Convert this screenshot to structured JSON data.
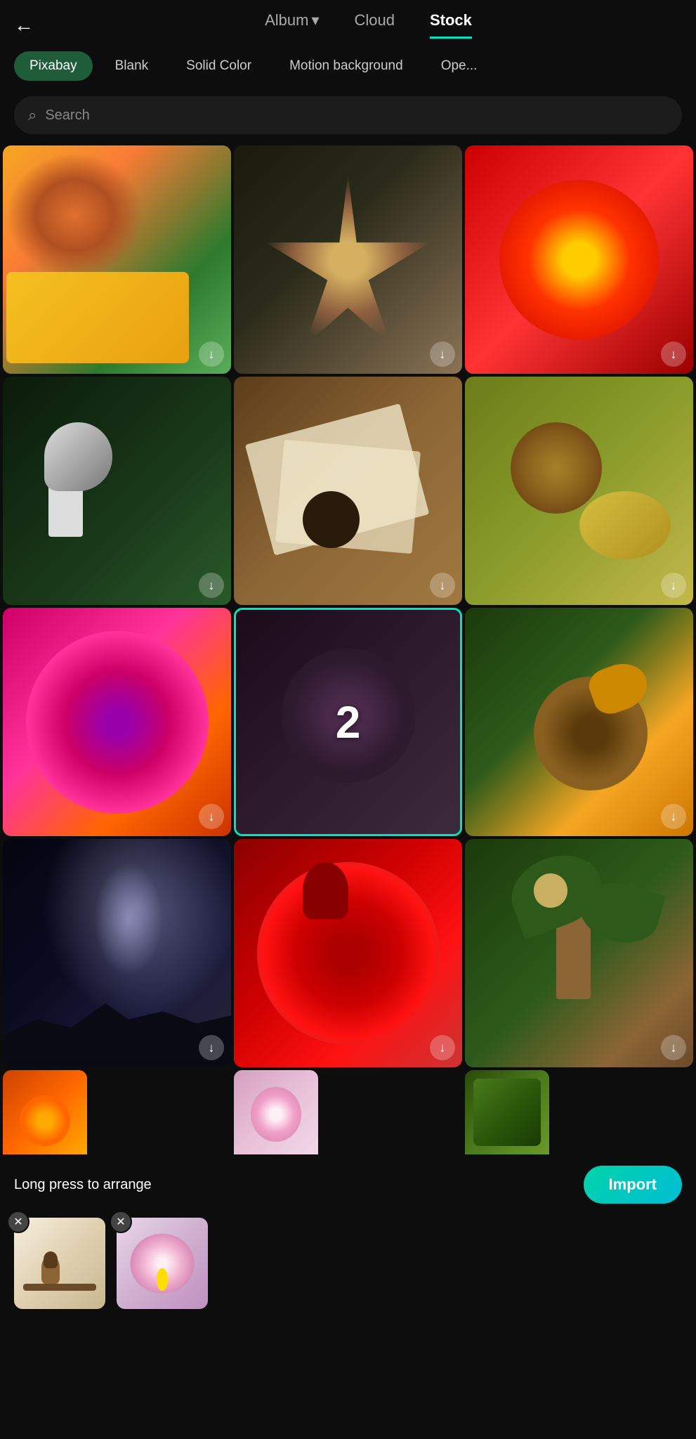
{
  "header": {
    "back_label": "←",
    "tabs": [
      {
        "id": "album",
        "label": "Album",
        "has_dropdown": true,
        "active": false
      },
      {
        "id": "cloud",
        "label": "Cloud",
        "active": false
      },
      {
        "id": "stock",
        "label": "Stock",
        "active": true
      }
    ]
  },
  "sub_tabs": [
    {
      "id": "pixabay",
      "label": "Pixabay",
      "active": true
    },
    {
      "id": "blank",
      "label": "Blank",
      "active": false
    },
    {
      "id": "solid_color",
      "label": "Solid Color",
      "active": false
    },
    {
      "id": "motion_background",
      "label": "Motion background",
      "active": false
    },
    {
      "id": "opacity",
      "label": "Ope...",
      "active": false
    }
  ],
  "search": {
    "placeholder": "Search"
  },
  "grid": {
    "items": [
      {
        "id": "butterfly",
        "type": "image",
        "theme": "butterfly",
        "downloaded": false
      },
      {
        "id": "star-flower",
        "type": "image",
        "theme": "star-flower",
        "downloaded": false
      },
      {
        "id": "red-flower-top",
        "type": "image",
        "theme": "red-flower-top",
        "downloaded": false
      },
      {
        "id": "heron",
        "type": "image",
        "theme": "heron",
        "downloaded": false
      },
      {
        "id": "newspaper",
        "type": "image",
        "theme": "newspaper",
        "downloaded": false
      },
      {
        "id": "bees",
        "type": "image",
        "theme": "bees",
        "downloaded": false
      },
      {
        "id": "dahlia-pink",
        "type": "image",
        "theme": "dahlia-pink",
        "downloaded": false
      },
      {
        "id": "dark-flower",
        "type": "image",
        "theme": "dark-flower",
        "selected": true,
        "badge": "2",
        "downloaded": false
      },
      {
        "id": "bee-sunflower",
        "type": "image",
        "theme": "bee-sunflower",
        "downloaded": false
      },
      {
        "id": "milky-way",
        "type": "image",
        "theme": "milky-way",
        "downloaded": false
      },
      {
        "id": "red-dahlia",
        "type": "image",
        "theme": "red-dahlia",
        "downloaded": false
      },
      {
        "id": "plant",
        "type": "image",
        "theme": "plant",
        "downloaded": false
      },
      {
        "id": "orange-partial",
        "type": "image",
        "theme": "orange-partial",
        "partial": true
      },
      {
        "id": "pink-partial",
        "type": "image",
        "theme": "pink-partial",
        "partial": true
      },
      {
        "id": "green-partial",
        "type": "image",
        "theme": "green-partial",
        "partial": true
      }
    ]
  },
  "bottom": {
    "long_press_label": "Long press to arrange",
    "import_button_label": "Import",
    "selected_thumbs": [
      {
        "id": "thumb1",
        "theme": "bird-branch"
      },
      {
        "id": "thumb2",
        "theme": "pink-lotus"
      }
    ]
  },
  "icons": {
    "back": "←",
    "dropdown": "▾",
    "search": "⌕",
    "download": "↓",
    "remove": "✕"
  }
}
